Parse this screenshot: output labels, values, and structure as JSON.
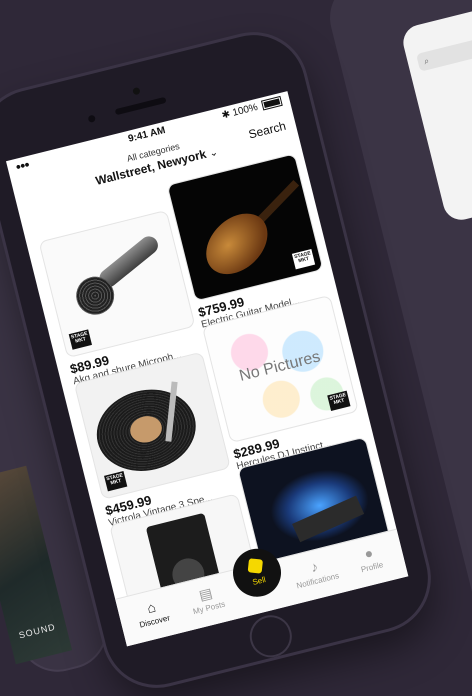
{
  "status": {
    "time": "9:41 AM",
    "battery": "100%"
  },
  "header": {
    "category": "All categories",
    "location": "Wallstreet, Newyork",
    "search_label": "Search"
  },
  "brand_logo": "STAGE MARKET",
  "listings": [
    {
      "price": "$89.99",
      "title": "Akg and shure Microph..."
    },
    {
      "price": "$759.99",
      "title": "Electric Guitar Model..."
    },
    {
      "price": "$459.99",
      "title": "Victrola Vintage 3 Spe..."
    },
    {
      "price": "$289.99",
      "title": "Hercules DJ Instinct...",
      "placeholder": "No Pictures"
    },
    {
      "price": "",
      "title": ""
    },
    {
      "price": "",
      "title": ""
    }
  ],
  "tabs": {
    "discover": "Discover",
    "my_posts": "My Posts",
    "sell": "Sell",
    "notifications": "Notifications",
    "profile": "Profile"
  },
  "background": {
    "left_strip_text": "SOUND"
  },
  "colors": {
    "accent": "#f5d800",
    "background": "#2f2838"
  }
}
